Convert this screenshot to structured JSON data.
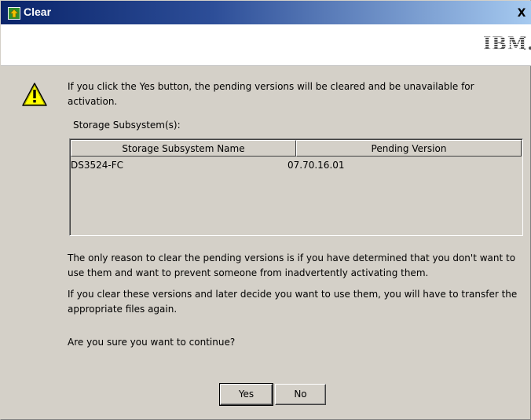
{
  "window": {
    "title": "Clear",
    "close_glyph": "X",
    "logo_text": "IBM."
  },
  "message": {
    "intro": "If you click the Yes button, the pending versions will be cleared and be unavailable for activation.",
    "subsystem_label": "Storage Subsystem(s):"
  },
  "table": {
    "columns": [
      "Storage Subsystem Name",
      "Pending Version"
    ],
    "rows": [
      [
        "DS3524-FC",
        "07.70.16.01"
      ]
    ]
  },
  "notes": {
    "reason": "The only reason to clear the pending versions is if you have determined that you don't want to use them and want to prevent someone from inadvertently activating them.",
    "later": "If you clear these versions and later decide you want to use them, you will have to transfer the appropriate files again.",
    "confirm": "Are you sure you want to continue?"
  },
  "buttons": {
    "yes": "Yes",
    "no": "No"
  },
  "icons": {
    "title_icon": "firmware-upload-icon",
    "warning": "warning-icon",
    "close": "close-icon"
  },
  "colors": {
    "titlebar_start": "#0a246a",
    "titlebar_end": "#a6caf0",
    "dialog_bg": "#d4d0c8",
    "warning_yellow": "#ffff00"
  }
}
